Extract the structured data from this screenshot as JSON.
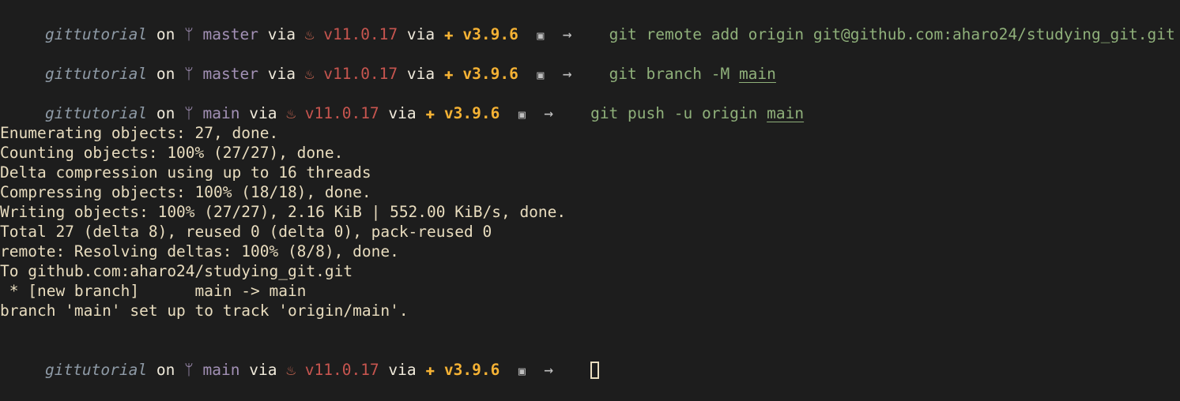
{
  "prompts": [
    {
      "dir": "gittutorial",
      "on": "on",
      "branch_icon": "git-branch-icon",
      "branch": "master",
      "via1": "via",
      "java_icon": "java-icon",
      "java": "v11.0.17",
      "via2": "via",
      "python_icon": "python-icon",
      "python": "v3.9.6",
      "save_icon": "save-icon",
      "arrow": "→",
      "command": "git remote add origin git@github.com:aharo24/studying_git.git",
      "underlined": ""
    },
    {
      "dir": "gittutorial",
      "on": "on",
      "branch_icon": "git-branch-icon",
      "branch": "master",
      "via1": "via",
      "java_icon": "java-icon",
      "java": "v11.0.17",
      "via2": "via",
      "python_icon": "python-icon",
      "python": "v3.9.6",
      "save_icon": "save-icon",
      "arrow": "→",
      "command": "git branch -M ",
      "underlined": "main"
    },
    {
      "dir": "gittutorial",
      "on": "on",
      "branch_icon": "git-branch-icon",
      "branch": "main",
      "via1": "via",
      "java_icon": "java-icon",
      "java": "v11.0.17",
      "via2": "via",
      "python_icon": "python-icon",
      "python": "v3.9.6",
      "save_icon": "save-icon",
      "arrow": "→",
      "command": "git push -u origin ",
      "underlined": "main"
    },
    {
      "dir": "gittutorial",
      "on": "on",
      "branch_icon": "git-branch-icon",
      "branch": "main",
      "via1": "via",
      "java_icon": "java-icon",
      "java": "v11.0.17",
      "via2": "via",
      "python_icon": "python-icon",
      "python": "v3.9.6",
      "save_icon": "save-icon",
      "arrow": "→",
      "command": "",
      "underlined": ""
    }
  ],
  "output": [
    "Enumerating objects: 27, done.",
    "Counting objects: 100% (27/27), done.",
    "Delta compression using up to 16 threads",
    "Compressing objects: 100% (18/18), done.",
    "Writing objects: 100% (27/27), 2.16 KiB | 552.00 KiB/s, done.",
    "Total 27 (delta 8), reused 0 (delta 0), pack-reused 0",
    "remote: Resolving deltas: 100% (8/8), done.",
    "To github.com:aharo24/studying_git.git",
    " * [new branch]      main -> main",
    "branch 'main' set up to track 'origin/main'."
  ],
  "colors": {
    "background": "#1d1d1d",
    "text": "#e9ddbf",
    "directory": "#8e9aa6",
    "branch": "#a290b5",
    "java": "#c7554f",
    "python": "#f5b234",
    "command": "#8fb07a"
  }
}
